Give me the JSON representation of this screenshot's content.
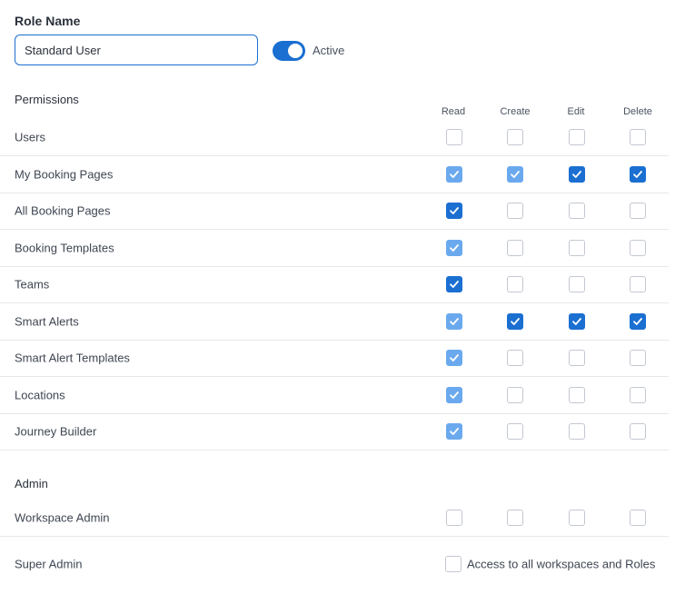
{
  "role_name": {
    "label": "Role Name",
    "value": "Standard User"
  },
  "status": {
    "label": "Active",
    "on": true
  },
  "permissions": {
    "title": "Permissions",
    "columns": [
      "Read",
      "Create",
      "Edit",
      "Delete"
    ],
    "rows": [
      {
        "label": "Users",
        "states": [
          "off",
          "off",
          "off",
          "off"
        ]
      },
      {
        "label": "My Booking Pages",
        "states": [
          "light",
          "light",
          "on",
          "on"
        ]
      },
      {
        "label": "All Booking Pages",
        "states": [
          "on",
          "off",
          "off",
          "off"
        ]
      },
      {
        "label": "Booking Templates",
        "states": [
          "light",
          "off",
          "off",
          "off"
        ]
      },
      {
        "label": "Teams",
        "states": [
          "on",
          "off",
          "off",
          "off"
        ]
      },
      {
        "label": "Smart Alerts",
        "states": [
          "light",
          "on",
          "on",
          "on"
        ]
      },
      {
        "label": "Smart Alert Templates",
        "states": [
          "light",
          "off",
          "off",
          "off"
        ]
      },
      {
        "label": "Locations",
        "states": [
          "light",
          "off",
          "off",
          "off"
        ]
      },
      {
        "label": "Journey Builder",
        "states": [
          "light",
          "off",
          "off",
          "off"
        ]
      }
    ]
  },
  "admin": {
    "title": "Admin",
    "workspace_admin": {
      "label": "Workspace Admin",
      "states": [
        "off",
        "off",
        "off",
        "off"
      ]
    },
    "super_admin": {
      "label": "Super Admin",
      "option_label": "Access to all workspaces and Roles"
    }
  },
  "colors": {
    "accent": "#1a6fd1",
    "accent_light": "#6aa9ee",
    "divider": "#e6e8ec"
  }
}
